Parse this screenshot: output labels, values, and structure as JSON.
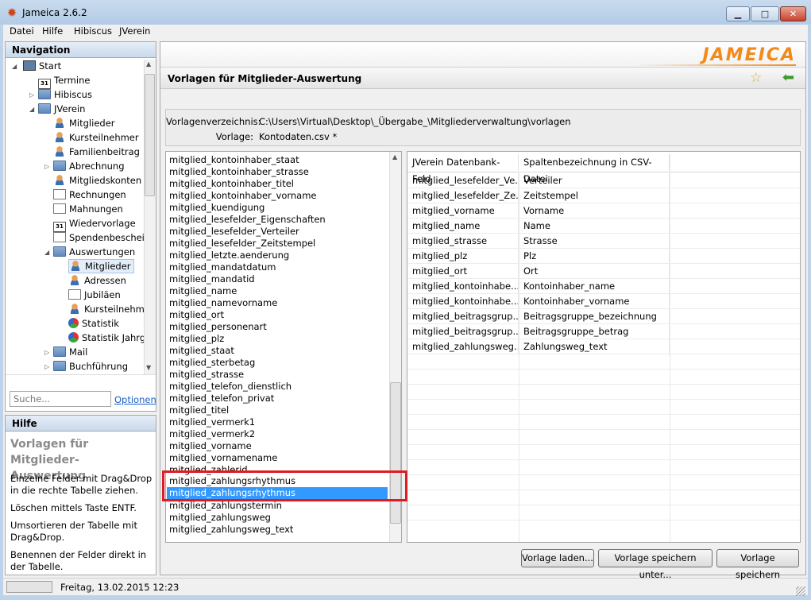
{
  "window": {
    "title": "Jameica 2.6.2"
  },
  "menubar": [
    "Datei",
    "Hilfe",
    "Hibiscus",
    "JVerein"
  ],
  "navigation": {
    "title": "Navigation",
    "items": [
      {
        "label": "Start",
        "icon": "monitor-icon"
      },
      {
        "label": "Termine",
        "icon": "calendar-icon"
      },
      {
        "label": "Hibiscus",
        "icon": "folder-icon"
      },
      {
        "label": "JVerein",
        "icon": "folder-open-icon"
      },
      {
        "label": "Mitglieder",
        "icon": "person-icon"
      },
      {
        "label": "Kursteilnehmer",
        "icon": "person-icon"
      },
      {
        "label": "Familienbeitrag",
        "icon": "family-icon"
      },
      {
        "label": "Abrechnung",
        "icon": "folder-icon"
      },
      {
        "label": "Mitgliedskonten",
        "icon": "accounts-icon"
      },
      {
        "label": "Rechnungen",
        "icon": "document-icon"
      },
      {
        "label": "Mahnungen",
        "icon": "document-icon"
      },
      {
        "label": "Wiedervorlage",
        "icon": "calendar-icon"
      },
      {
        "label": "Spendenbescheir",
        "icon": "document-icon"
      },
      {
        "label": "Auswertungen",
        "icon": "folder-open-icon"
      },
      {
        "label": "Mitglieder",
        "icon": "person-icon"
      },
      {
        "label": "Adressen",
        "icon": "person-icon"
      },
      {
        "label": "Jubiläen",
        "icon": "document-icon"
      },
      {
        "label": "Kursteilnehm",
        "icon": "person-icon"
      },
      {
        "label": "Statistik",
        "icon": "pie-chart-icon"
      },
      {
        "label": "Statistik Jahrg",
        "icon": "pie-chart-icon"
      },
      {
        "label": "Mail",
        "icon": "folder-icon"
      },
      {
        "label": "Buchführung",
        "icon": "folder-icon"
      }
    ],
    "search_placeholder": "Suche...",
    "options_link": "Optionen"
  },
  "help": {
    "header": "Hilfe",
    "title": "Vorlagen für Mitglieder-Auswertung",
    "paragraphs": [
      "Einzelne Felder mit Drag&Drop in die rechte Tabelle ziehen.",
      "Löschen mittels Taste ENTF.",
      "Umsortieren der Tabelle mit Drag&Drop.",
      "Benennen der Felder direkt in der Tabelle."
    ]
  },
  "status": {
    "datetime": "Freitag, 13.02.2015 12:23"
  },
  "main": {
    "logo": "JAMEICA",
    "page_title": "Vorlagen für Mitglieder-Auswertung",
    "template_dir_label": "Vorlagenverzeichnis:",
    "template_dir_value": "C:\\Users\\Virtual\\Desktop\\_Übergabe_\\Mitgliederverwaltung\\vorlagen",
    "template_label": "Vorlage:",
    "template_value": "Kontodaten.csv *",
    "fields": [
      "mitglied_kontoinhaber_staat",
      "mitglied_kontoinhaber_strasse",
      "mitglied_kontoinhaber_titel",
      "mitglied_kontoinhaber_vorname",
      "mitglied_kuendigung",
      "mitglied_lesefelder_Eigenschaften",
      "mitglied_lesefelder_Verteiler",
      "mitglied_lesefelder_Zeitstempel",
      "mitglied_letzte.aenderung",
      "mitglied_mandatdatum",
      "mitglied_mandatid",
      "mitglied_name",
      "mitglied_namevorname",
      "mitglied_ort",
      "mitglied_personenart",
      "mitglied_plz",
      "mitglied_staat",
      "mitglied_sterbetag",
      "mitglied_strasse",
      "mitglied_telefon_dienstlich",
      "mitglied_telefon_privat",
      "mitglied_titel",
      "mitglied_vermerk1",
      "mitglied_vermerk2",
      "mitglied_vorname",
      "mitglied_vornamename",
      "mitglied_zahlerid",
      "mitglied_zahlungsrhythmus",
      "mitglied_zahlungsrhythmus",
      "mitglied_zahlungstermin",
      "mitglied_zahlungsweg",
      "mitglied_zahlungsweg_text"
    ],
    "table": {
      "headers": [
        "JVerein Datenbank-Feld",
        "Spaltenbezeichnung in CSV-Datei"
      ],
      "rows": [
        [
          "mitglied_lesefelder_Ve...",
          "Verteiler"
        ],
        [
          "mitglied_lesefelder_Ze...",
          "Zeitstempel"
        ],
        [
          "mitglied_vorname",
          "Vorname"
        ],
        [
          "mitglied_name",
          "Name"
        ],
        [
          "mitglied_strasse",
          "Strasse"
        ],
        [
          "mitglied_plz",
          "Plz"
        ],
        [
          "mitglied_ort",
          "Ort"
        ],
        [
          "mitglied_kontoinhabe...",
          "Kontoinhaber_name"
        ],
        [
          "mitglied_kontoinhabe...",
          "Kontoinhaber_vorname"
        ],
        [
          "mitglied_beitragsgrup...",
          "Beitragsgruppe_bezeichnung"
        ],
        [
          "mitglied_beitragsgrup...",
          "Beitragsgruppe_betrag"
        ],
        [
          "mitglied_zahlungsweg...",
          "Zahlungsweg_text"
        ]
      ]
    },
    "buttons": {
      "load": "Vorlage laden...",
      "save_as": "Vorlage speichern unter...",
      "save": "Vorlage speichern"
    }
  }
}
